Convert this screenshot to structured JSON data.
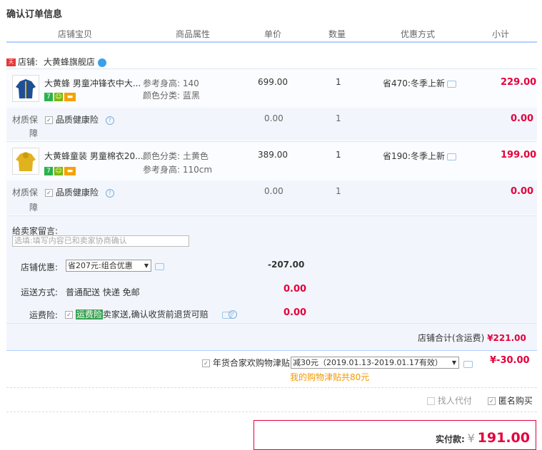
{
  "title": "确认订单信息",
  "headers": [
    "店铺宝贝",
    "商品属性",
    "单价",
    "数量",
    "优惠方式",
    "小计"
  ],
  "store": {
    "tag": "天猫",
    "label": "店铺:",
    "name": "大黄蜂旗舰店"
  },
  "items": [
    {
      "name": "大黄蜂 男童冲锋衣中大...",
      "attr1": "参考身高: 140",
      "attr2": "颜色分类: 蓝黑",
      "price": "699.00",
      "qty": "1",
      "promo": "省470:冬季上新",
      "subtotal": "229.00",
      "badges": [
        "7",
        "☺",
        "▬"
      ],
      "color": "#1f4f97"
    },
    {
      "name": "大黄蜂童装 男童棉衣20...",
      "attr1": "颜色分类: 土黄色",
      "attr2": "参考身高: 110cm",
      "price": "389.00",
      "qty": "1",
      "promo": "省190:冬季上新",
      "subtotal": "199.00",
      "badges": [
        "7",
        "☺",
        "▬"
      ],
      "color": "#e0b21d"
    }
  ],
  "insurance": {
    "label1": "材质保",
    "label2": "障",
    "name": "品质健康险",
    "price": "0.00",
    "qty": "1",
    "subtotal": "0.00"
  },
  "message": {
    "label": "给卖家留言:",
    "placeholder": "选填:填写内容已和卖家协商确认"
  },
  "store_discount": {
    "label": "店铺优惠:",
    "option": "省207元:组合优惠",
    "value": "-207.00"
  },
  "shipping": {
    "label": "运送方式:",
    "text": "普通配送 快递 免邮",
    "value": "0.00"
  },
  "freight_ins": {
    "label": "运费险:",
    "name": "运费险",
    "desc": "卖家送,确认收货前退货可赔",
    "value": "0.00"
  },
  "store_total": {
    "label": "店铺合计(含运费)",
    "value": "¥221.00"
  },
  "subsidy": {
    "label": "年货合家欢购物津贴",
    "option": "减30元（2019.01.13-2019.01.17有效）",
    "value": "¥-30.00",
    "note": "我的购物津贴共80元"
  },
  "options": {
    "proxy": "找人代付",
    "anon": "匿名购买"
  },
  "payment": {
    "label": "实付款:",
    "currency": "¥",
    "amount": "191.00"
  },
  "colors": {
    "accent": "#e4003c",
    "border": "#b2d1ff",
    "promo_note": "#f39800"
  }
}
